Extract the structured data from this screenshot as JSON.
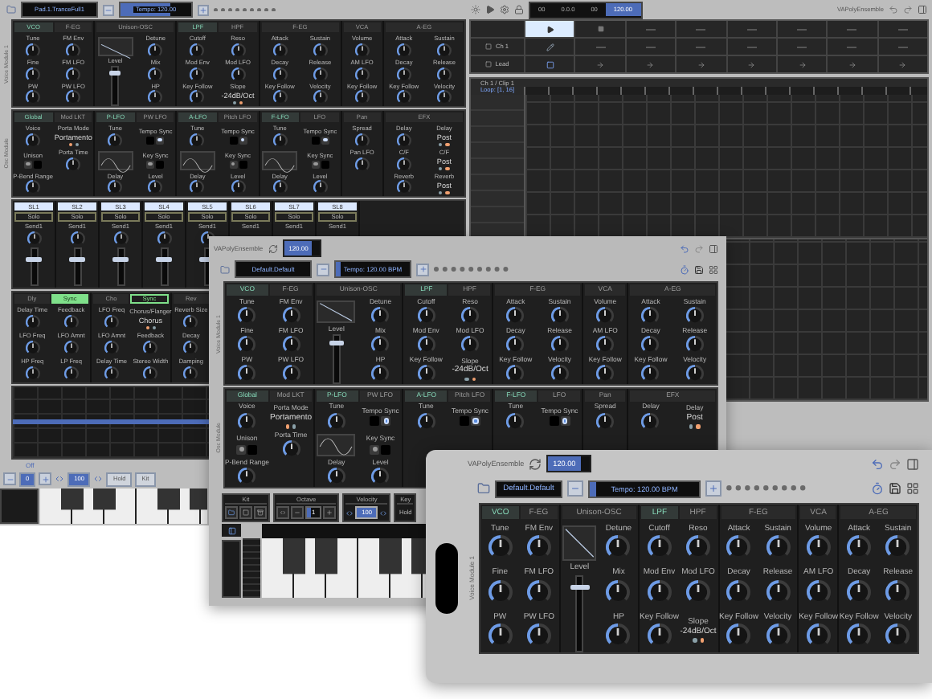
{
  "back_window": {
    "preset": "Pad.1.TranceFull1",
    "tempo": {
      "label": "Tempo: 120.00",
      "level": 0.7
    },
    "transport": [
      {
        "text": "00",
        "selected": false
      },
      {
        "text": "0.0.0",
        "selected": false
      },
      {
        "text": "00",
        "selected": false
      },
      {
        "text": "120.00",
        "selected": true
      }
    ],
    "app_name": "VAPolyEnsemble",
    "module_labels": [
      "Voice Module 1",
      "Osc Module"
    ],
    "voice_module": [
      {
        "kind": "wide",
        "tabs": [
          {
            "label": "VCO",
            "selected": true
          },
          {
            "label": "F-EG",
            "selected": false
          }
        ],
        "params": [
          {
            "kind": "knob",
            "label": "Tune"
          },
          {
            "kind": "knob",
            "label": "FM Env"
          },
          {
            "kind": "knob",
            "label": "Fine"
          },
          {
            "kind": "knob",
            "label": "FM LFO"
          },
          {
            "kind": "knob",
            "label": "PW"
          },
          {
            "kind": "knob",
            "label": "PW LFO"
          }
        ]
      },
      {
        "kind": "wide",
        "tabs": [
          {
            "label": "Unison-OSC",
            "selected": false
          }
        ],
        "params": [
          {
            "kind": "env_graph"
          },
          {
            "kind": "knob",
            "label": "Detune"
          },
          {
            "kind": "slider",
            "label": "Level",
            "level": 0.85
          },
          {
            "kind": "knob",
            "label": "Mix"
          },
          {
            "kind": "knob",
            "label": "HP"
          }
        ]
      },
      {
        "kind": "wide",
        "tabs": [
          {
            "label": "LPF",
            "selected": true
          },
          {
            "label": "HPF",
            "selected": false
          }
        ],
        "params": [
          {
            "kind": "knob",
            "label": "Cutoff"
          },
          {
            "kind": "knob",
            "label": "Reso"
          },
          {
            "kind": "knob",
            "label": "Mod Env"
          },
          {
            "kind": "knob",
            "label": "Mod LFO"
          },
          {
            "kind": "knob",
            "label": "Key Follow"
          },
          {
            "kind": "choice",
            "label": "Slope",
            "value": "-24dB/Oct",
            "dots": [
              {
                "selected": false
              },
              {
                "selected": true
              }
            ]
          }
        ]
      },
      {
        "kind": "wide",
        "tabs": [
          {
            "label": "F-EG",
            "selected": false
          }
        ],
        "params": [
          {
            "kind": "knob",
            "label": "Attack"
          },
          {
            "kind": "knob",
            "label": "Sustain"
          },
          {
            "kind": "knob",
            "label": "Decay"
          },
          {
            "kind": "knob",
            "label": "Release"
          },
          {
            "kind": "knob",
            "label": "Key Follow"
          },
          {
            "kind": "knob",
            "label": "Velocity"
          }
        ]
      },
      {
        "kind": "narrow",
        "tabs": [
          {
            "label": "VCA",
            "selected": false
          }
        ],
        "params": [
          {
            "kind": "knob",
            "label": "Volume"
          },
          {
            "kind": "knob",
            "label": "AM LFO"
          },
          {
            "kind": "knob",
            "label": "Key Follow"
          }
        ]
      },
      {
        "kind": "wide",
        "tabs": [
          {
            "label": "A-EG",
            "selected": false
          }
        ],
        "params": [
          {
            "kind": "knob",
            "label": "Attack"
          },
          {
            "kind": "knob",
            "label": "Sustain"
          },
          {
            "kind": "knob",
            "label": "Decay"
          },
          {
            "kind": "knob",
            "label": "Release"
          },
          {
            "kind": "knob",
            "label": "Key Follow"
          },
          {
            "kind": "knob",
            "label": "Velocity"
          }
        ]
      }
    ],
    "osc_module": [
      {
        "kind": "wide",
        "tabs": [
          {
            "label": "Global",
            "selected": true
          },
          {
            "label": "Mod LKT",
            "selected": false
          }
        ],
        "params": [
          {
            "kind": "knob",
            "label": "Voice"
          },
          {
            "kind": "choice",
            "label": "Porta Mode",
            "value": "Portamento",
            "dots": [
              {
                "selected": true
              },
              {
                "selected": false
              }
            ]
          },
          {
            "kind": "toggle",
            "label": "Unison",
            "on": false
          },
          {
            "kind": "knob",
            "label": "Porta Time"
          },
          {
            "kind": "knob",
            "label": "P-Bend Range"
          }
        ]
      },
      {
        "kind": "wide",
        "tabs": [
          {
            "label": "P-LFO",
            "selected": true
          },
          {
            "label": "PW LFO",
            "selected": false
          }
        ],
        "params": [
          {
            "kind": "knob",
            "label": "Tune"
          },
          {
            "kind": "toggle",
            "label": "Tempo Sync",
            "on": true
          },
          {
            "kind": "wave_graph"
          },
          {
            "kind": "toggle",
            "label": "Key Sync",
            "on": false
          },
          {
            "kind": "knob",
            "label": "Delay"
          },
          {
            "kind": "knob",
            "label": "Level"
          }
        ]
      },
      {
        "kind": "wide",
        "tabs": [
          {
            "label": "A-LFO",
            "selected": true
          },
          {
            "label": "Pitch LFO",
            "selected": false
          }
        ],
        "params": [
          {
            "kind": "knob",
            "label": "Tune"
          },
          {
            "kind": "toggle",
            "label": "Tempo Sync",
            "on": true
          },
          {
            "kind": "wave_graph"
          },
          {
            "kind": "toggle",
            "label": "Key Sync",
            "on": false
          },
          {
            "kind": "knob",
            "label": "Delay"
          },
          {
            "kind": "knob",
            "label": "Level"
          }
        ]
      },
      {
        "kind": "wide",
        "tabs": [
          {
            "label": "F-LFO",
            "selected": true
          },
          {
            "label": "LFO",
            "selected": false
          }
        ],
        "params": [
          {
            "kind": "knob",
            "label": "Tune"
          },
          {
            "kind": "toggle",
            "label": "Tempo Sync",
            "on": true
          },
          {
            "kind": "wave_graph"
          },
          {
            "kind": "toggle",
            "label": "Key Sync",
            "on": false
          },
          {
            "kind": "knob",
            "label": "Delay"
          },
          {
            "kind": "knob",
            "label": "Level"
          }
        ]
      },
      {
        "kind": "narrow",
        "tabs": [
          {
            "label": "Pan",
            "selected": false
          }
        ],
        "params": [
          {
            "kind": "knob",
            "label": "Spread"
          },
          {
            "kind": "knob",
            "label": "Pan LFO"
          }
        ]
      },
      {
        "kind": "wide",
        "tabs": [
          {
            "label": "EFX",
            "selected": false
          }
        ],
        "params": [
          {
            "kind": "knob",
            "label": "Delay"
          },
          {
            "kind": "choice",
            "label": "Delay",
            "value": "Post",
            "dots": [
              {
                "selected": false
              },
              {
                "selected": true
              }
            ]
          },
          {
            "kind": "knob",
            "label": "C/F"
          },
          {
            "kind": "choice",
            "label": "C/F",
            "value": "Post",
            "dots": [
              {
                "selected": false
              },
              {
                "selected": true
              }
            ]
          },
          {
            "kind": "knob",
            "label": "Reverb"
          },
          {
            "kind": "choice",
            "label": "Reverb",
            "value": "Post",
            "dots": [
              {
                "selected": false
              },
              {
                "selected": true
              }
            ]
          }
        ]
      }
    ],
    "sends": [
      {
        "label": "SL1",
        "solo": "Solo",
        "send": "Send1",
        "level": 0.7
      },
      {
        "label": "SL2",
        "solo": "Solo",
        "send": "Send1",
        "level": 0.7
      },
      {
        "label": "SL3",
        "solo": "Solo",
        "send": "Send1",
        "level": 0.7
      },
      {
        "label": "SL4",
        "solo": "Solo",
        "send": "Send1",
        "level": 0.7
      },
      {
        "label": "SL5",
        "solo": "Solo",
        "send": "Send1",
        "level": 0.7
      },
      {
        "label": "SL6",
        "solo": "Solo",
        "send": "Send1"
      },
      {
        "label": "SL7",
        "solo": "Solo",
        "send": "Send1"
      },
      {
        "label": "SL8",
        "solo": "Solo",
        "send": "Send1"
      }
    ],
    "effects": [
      {
        "kind": "wide",
        "tabs": [
          {
            "label": "Dly",
            "selected": false
          }
        ],
        "sync": {
          "label": "Sync",
          "on": true
        },
        "params": [
          {
            "kind": "knob",
            "label": "Delay Time"
          },
          {
            "kind": "knob",
            "label": "Feedback"
          },
          {
            "kind": "knob",
            "label": "LFO Freq"
          },
          {
            "kind": "knob",
            "label": "LFO Amnt"
          },
          {
            "kind": "knob",
            "label": "HP Freq"
          },
          {
            "kind": "knob",
            "label": "LP Freq"
          }
        ]
      },
      {
        "kind": "wide",
        "tabs": [
          {
            "label": "Cho",
            "selected": false
          }
        ],
        "sync": {
          "label": "Sync",
          "on": false
        },
        "params": [
          {
            "kind": "knob",
            "label": "LFO Freq"
          },
          {
            "kind": "choice",
            "label": "Chorus/Flanger",
            "value": "Chorus",
            "dots": [
              {
                "selected": true
              },
              {
                "selected": false
              }
            ]
          },
          {
            "kind": "knob",
            "label": "LFO Amnt"
          },
          {
            "kind": "knob",
            "label": "Feedback"
          },
          {
            "kind": "knob",
            "label": "Delay Time"
          },
          {
            "kind": "knob",
            "label": "Stereo Width"
          }
        ]
      },
      {
        "kind": "narrow",
        "tabs": [
          {
            "label": "Rev",
            "selected": false
          }
        ],
        "params": [
          {
            "kind": "knob",
            "label": "Reverb Size"
          },
          {
            "kind": "knob",
            "label": "Decay"
          },
          {
            "kind": "knob",
            "label": "Damping"
          }
        ]
      }
    ],
    "graph_label": "Off",
    "keys_bar": {
      "octave": "0",
      "velocity": "100",
      "hold": "Hold",
      "kit": "Kit"
    },
    "sequencer": [
      {
        "cells": [
          {
            "kind": "play",
            "selected": true
          },
          {
            "kind": "stop",
            "selected": false
          },
          {
            "kind": "empty"
          },
          {
            "kind": "empty"
          },
          {
            "kind": "empty"
          },
          {
            "kind": "empty"
          },
          {
            "kind": "empty"
          },
          {
            "kind": "empty"
          }
        ]
      },
      {
        "label": "Ch 1",
        "cells": [
          {
            "kind": "edit"
          },
          {
            "kind": "empty"
          },
          {
            "kind": "empty"
          },
          {
            "kind": "empty"
          },
          {
            "kind": "empty"
          },
          {
            "kind": "empty"
          },
          {
            "kind": "empty"
          },
          {
            "kind": "empty"
          }
        ]
      },
      {
        "label": "Lead",
        "cells": [
          {
            "kind": "clip"
          },
          {
            "kind": "arrow"
          },
          {
            "kind": "arrow"
          },
          {
            "kind": "arrow"
          },
          {
            "kind": "arrow"
          },
          {
            "kind": "arrow"
          },
          {
            "kind": "arrow"
          },
          {
            "kind": "arrow"
          }
        ]
      }
    ],
    "clip": {
      "title": "Ch 1 / Clip 1",
      "loop": "Loop: [1, 16]"
    }
  },
  "middle_window": {
    "app_name": "VAPolyEnsemble",
    "tempo": "120.00",
    "preset": "Default.Default",
    "tempo_slider": {
      "label": "Tempo: 120.00 BPM",
      "level": 0.06
    },
    "module_labels": [
      "Voice Module 1",
      "Osc Module"
    ],
    "voice_module": [
      {
        "kind": "wide",
        "tabs": [
          {
            "label": "VCO",
            "selected": true
          },
          {
            "label": "F-EG",
            "selected": false
          }
        ],
        "params": [
          {
            "kind": "knob",
            "label": "Tune"
          },
          {
            "kind": "knob",
            "label": "FM Env"
          },
          {
            "kind": "knob",
            "label": "Fine"
          },
          {
            "kind": "knob",
            "label": "FM LFO"
          },
          {
            "kind": "knob",
            "label": "PW"
          },
          {
            "kind": "knob",
            "label": "PW LFO"
          }
        ]
      },
      {
        "kind": "wide",
        "tabs": [
          {
            "label": "Unison-OSC",
            "selected": false
          }
        ],
        "params": [
          {
            "kind": "env_graph"
          },
          {
            "kind": "knob",
            "label": "Detune"
          },
          {
            "kind": "slider",
            "label": "Level",
            "level": 0.85
          },
          {
            "kind": "knob",
            "label": "Mix"
          },
          {
            "kind": "knob",
            "label": "HP"
          }
        ]
      },
      {
        "kind": "wide",
        "tabs": [
          {
            "label": "LPF",
            "selected": true
          },
          {
            "label": "HPF",
            "selected": false
          }
        ],
        "params": [
          {
            "kind": "knob",
            "label": "Cutoff"
          },
          {
            "kind": "knob",
            "label": "Reso"
          },
          {
            "kind": "knob",
            "label": "Mod Env"
          },
          {
            "kind": "knob",
            "label": "Mod LFO"
          },
          {
            "kind": "knob",
            "label": "Key Follow"
          },
          {
            "kind": "choice",
            "label": "Slope",
            "value": "-24dB/Oct",
            "dots": [
              {
                "selected": false
              },
              {
                "selected": true
              }
            ]
          }
        ]
      },
      {
        "kind": "wide",
        "tabs": [
          {
            "label": "F-EG",
            "selected": false
          }
        ],
        "params": [
          {
            "kind": "knob",
            "label": "Attack"
          },
          {
            "kind": "knob",
            "label": "Sustain"
          },
          {
            "kind": "knob",
            "label": "Decay"
          },
          {
            "kind": "knob",
            "label": "Release"
          },
          {
            "kind": "knob",
            "label": "Key Follow"
          },
          {
            "kind": "knob",
            "label": "Velocity"
          }
        ]
      },
      {
        "kind": "narrow",
        "tabs": [
          {
            "label": "VCA",
            "selected": false
          }
        ],
        "params": [
          {
            "kind": "knob",
            "label": "Volume"
          },
          {
            "kind": "knob",
            "label": "AM LFO"
          },
          {
            "kind": "knob",
            "label": "Key Follow"
          }
        ]
      },
      {
        "kind": "wide",
        "tabs": [
          {
            "label": "A-EG",
            "selected": false
          }
        ],
        "params": [
          {
            "kind": "knob",
            "label": "Attack"
          },
          {
            "kind": "knob",
            "label": "Sustain"
          },
          {
            "kind": "knob",
            "label": "Decay"
          },
          {
            "kind": "knob",
            "label": "Release"
          },
          {
            "kind": "knob",
            "label": "Key Follow"
          },
          {
            "kind": "knob",
            "label": "Velocity"
          }
        ]
      }
    ],
    "osc_module": [
      {
        "kind": "wide",
        "tabs": [
          {
            "label": "Global",
            "selected": true
          },
          {
            "label": "Mod LKT",
            "selected": false
          }
        ],
        "params": [
          {
            "kind": "knob",
            "label": "Voice"
          },
          {
            "kind": "choice",
            "label": "Porta Mode",
            "value": "Portamento",
            "dots": [
              {
                "selected": true
              },
              {
                "selected": false
              }
            ]
          },
          {
            "kind": "toggle",
            "label": "Unison",
            "on": false
          },
          {
            "kind": "knob",
            "label": "Porta Time"
          },
          {
            "kind": "knob",
            "label": "P-Bend Range"
          }
        ]
      },
      {
        "kind": "wide",
        "tabs": [
          {
            "label": "P-LFO",
            "selected": true
          },
          {
            "label": "PW LFO",
            "selected": false
          }
        ],
        "params": [
          {
            "kind": "knob",
            "label": "Tune"
          },
          {
            "kind": "toggle",
            "label": "Tempo Sync",
            "on": true
          },
          {
            "kind": "wave_graph"
          },
          {
            "kind": "toggle",
            "label": "Key Sync",
            "on": false
          },
          {
            "kind": "knob",
            "label": "Delay"
          },
          {
            "kind": "knob",
            "label": "Level"
          }
        ]
      },
      {
        "kind": "wide",
        "tabs": [
          {
            "label": "A-LFO",
            "selected": true
          },
          {
            "label": "Pitch LFO",
            "selected": false
          }
        ],
        "params": [
          {
            "kind": "knob",
            "label": "Tune"
          },
          {
            "kind": "toggle",
            "label": "Tempo Sync",
            "on": true
          }
        ]
      },
      {
        "kind": "wide",
        "tabs": [
          {
            "label": "F-LFO",
            "selected": true
          },
          {
            "label": "LFO",
            "selected": false
          }
        ],
        "params": [
          {
            "kind": "knob",
            "label": "Tune"
          },
          {
            "kind": "toggle",
            "label": "Tempo Sync",
            "on": true
          }
        ]
      },
      {
        "kind": "narrow",
        "tabs": [
          {
            "label": "Pan",
            "selected": false
          }
        ],
        "params": [
          {
            "kind": "knob",
            "label": "Spread"
          }
        ]
      },
      {
        "kind": "wide",
        "tabs": [
          {
            "label": "EFX",
            "selected": false
          }
        ],
        "params": [
          {
            "kind": "knob",
            "label": "Delay"
          },
          {
            "kind": "choice",
            "label": "Delay",
            "value": "Post",
            "dots": [
              {
                "selected": false
              },
              {
                "selected": true
              }
            ]
          }
        ]
      }
    ],
    "keys": {
      "kit": "Kit",
      "octave": {
        "title": "Octave",
        "value": "1"
      },
      "velocity": {
        "title": "Velocity",
        "value": "100"
      },
      "key": {
        "title": "Key",
        "button": "Hold"
      }
    }
  },
  "front_window": {
    "app_name": "VAPolyEnsemble",
    "tempo": "120.00",
    "preset": "Default.Default",
    "tempo_slider": {
      "label": "Tempo: 120.00 BPM",
      "level": 0.06
    },
    "module_label": "Voice Module 1",
    "voice_module": [
      {
        "kind": "wide",
        "tabs": [
          {
            "label": "VCO",
            "selected": true
          },
          {
            "label": "F-EG",
            "selected": false
          }
        ],
        "params": [
          {
            "kind": "knob",
            "label": "Tune"
          },
          {
            "kind": "knob",
            "label": "FM Env"
          },
          {
            "kind": "knob",
            "label": "Fine"
          },
          {
            "kind": "knob",
            "label": "FM LFO"
          },
          {
            "kind": "knob",
            "label": "PW"
          },
          {
            "kind": "knob",
            "label": "PW LFO"
          }
        ]
      },
      {
        "kind": "wide",
        "tabs": [
          {
            "label": "Unison-OSC",
            "selected": false
          }
        ],
        "params": [
          {
            "kind": "env_graph"
          },
          {
            "kind": "knob",
            "label": "Detune"
          },
          {
            "kind": "slider",
            "label": "Level",
            "level": 0.85
          },
          {
            "kind": "knob",
            "label": "Mix"
          },
          {
            "kind": "knob",
            "label": "HP"
          }
        ]
      },
      {
        "kind": "wide",
        "tabs": [
          {
            "label": "LPF",
            "selected": true
          },
          {
            "label": "HPF",
            "selected": false
          }
        ],
        "params": [
          {
            "kind": "knob",
            "label": "Cutoff"
          },
          {
            "kind": "knob",
            "label": "Reso"
          },
          {
            "kind": "knob",
            "label": "Mod Env"
          },
          {
            "kind": "knob",
            "label": "Mod LFO"
          },
          {
            "kind": "knob",
            "label": "Key Follow"
          },
          {
            "kind": "choice",
            "label": "Slope",
            "value": "-24dB/Oct",
            "dots": [
              {
                "selected": false
              },
              {
                "selected": true
              }
            ]
          }
        ]
      },
      {
        "kind": "wide",
        "tabs": [
          {
            "label": "F-EG",
            "selected": false
          }
        ],
        "params": [
          {
            "kind": "knob",
            "label": "Attack"
          },
          {
            "kind": "knob",
            "label": "Sustain"
          },
          {
            "kind": "knob",
            "label": "Decay"
          },
          {
            "kind": "knob",
            "label": "Release"
          },
          {
            "kind": "knob",
            "label": "Key Follow"
          },
          {
            "kind": "knob",
            "label": "Velocity"
          }
        ]
      },
      {
        "kind": "narrow",
        "tabs": [
          {
            "label": "VCA",
            "selected": false
          }
        ],
        "params": [
          {
            "kind": "knob",
            "label": "Volume"
          },
          {
            "kind": "knob",
            "label": "AM LFO"
          },
          {
            "kind": "knob",
            "label": "Key Follow"
          }
        ]
      },
      {
        "kind": "wide",
        "tabs": [
          {
            "label": "A-EG",
            "selected": false
          }
        ],
        "params": [
          {
            "kind": "knob",
            "label": "Attack"
          },
          {
            "kind": "knob",
            "label": "Sustain"
          },
          {
            "kind": "knob",
            "label": "Decay"
          },
          {
            "kind": "knob",
            "label": "Release"
          },
          {
            "kind": "knob",
            "label": "Key Follow"
          },
          {
            "kind": "knob",
            "label": "Velocity"
          }
        ]
      }
    ]
  }
}
